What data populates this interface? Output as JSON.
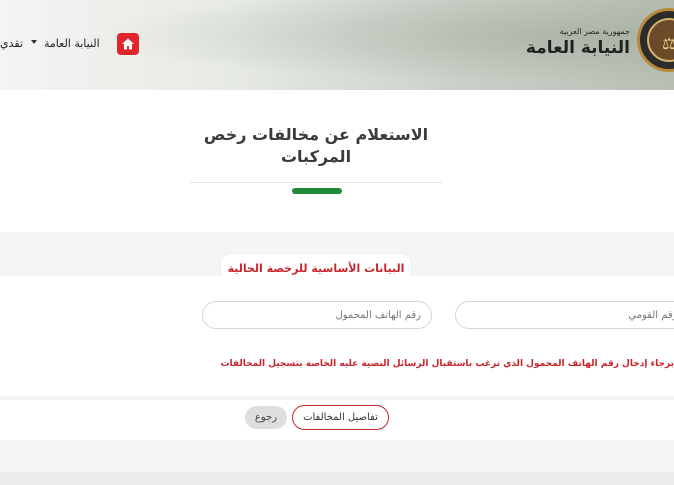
{
  "header": {
    "country": "جمهورية مصر العربية",
    "org_name": "النيابة العامة",
    "nav": {
      "item_main": "النيابة العامة",
      "item_submit": "تقدي"
    }
  },
  "page": {
    "title": "الاستعلام عن مخالفات رخص المركبات"
  },
  "form": {
    "legend": "البيانات الأساسية للرخصة الحالية",
    "national_id_placeholder": "الرقم القومي",
    "phone_placeholder": "رقم الهاتف المحمول",
    "note": "برجاء إدخال رقم الهاتف المحمول الذي ترغب باستقبال الرسائل النصية عليه الخاصة بتسجيل المخالفات",
    "details_button": "تفاصيل المخالفات",
    "back_button": "رجوع"
  },
  "colors": {
    "accent_red": "#c8242b",
    "accent_green": "#1e8a3a"
  }
}
